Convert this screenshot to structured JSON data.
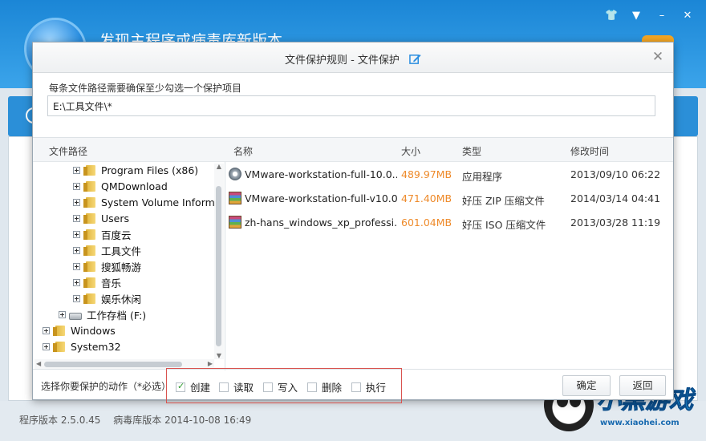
{
  "background": {
    "title": "发现主程序或病毒库新版本",
    "footer": {
      "program_version": "程序版本 2.5.0.45",
      "virus_db_version": "病毒库版本 2014-10-08 16:49"
    },
    "watermark": {
      "text": "小黑游戏",
      "url": "www.xiaohei.com"
    }
  },
  "dialog": {
    "title": "文件保护规则 - 文件保护",
    "hint": "每条文件路径需要确保至少勾选一个保护项目",
    "path_value": "E:\\工具文件\\*",
    "tree_header": "文件路径",
    "file_headers": {
      "name": "名称",
      "size": "大小",
      "type": "类型",
      "mtime": "修改时间"
    },
    "tree_items": [
      {
        "label": "Program Files (x86)",
        "icon": "folder-icon"
      },
      {
        "label": "QMDownload",
        "icon": "folder-icon"
      },
      {
        "label": "System Volume Informa",
        "icon": "folder-icon"
      },
      {
        "label": "Users",
        "icon": "folder-icon"
      },
      {
        "label": "百度云",
        "icon": "folder-icon"
      },
      {
        "label": "工具文件",
        "icon": "folder-icon",
        "selected": true
      },
      {
        "label": "搜狐畅游",
        "icon": "folder-icon"
      },
      {
        "label": "音乐",
        "icon": "folder-icon"
      },
      {
        "label": "娱乐休闲",
        "icon": "folder-icon"
      },
      {
        "label": "工作存档 (F:)",
        "icon": "drive-icon"
      },
      {
        "label": "Windows",
        "icon": "folder-icon"
      },
      {
        "label": "System32",
        "icon": "folder-icon"
      }
    ],
    "files": [
      {
        "name": "VMware-workstation-full-10.0...",
        "size": "489.97MB",
        "type": "应用程序",
        "mtime": "2013/09/10 06:22",
        "icon": "exe-icon"
      },
      {
        "name": "VMware-workstation-full-v10.0...",
        "size": "471.40MB",
        "type": "好压 ZIP 压缩文件",
        "mtime": "2014/03/14 04:41",
        "icon": "zip-archive-icon"
      },
      {
        "name": "zh-hans_windows_xp_professi...",
        "size": "601.04MB",
        "type": "好压 ISO 压缩文件",
        "mtime": "2013/03/28 11:19",
        "icon": "iso-archive-icon"
      }
    ],
    "actions_label": "选择你要保护的动作（*必选）",
    "actions": [
      {
        "label": "创建",
        "checked": true
      },
      {
        "label": "读取",
        "checked": false
      },
      {
        "label": "写入",
        "checked": false
      },
      {
        "label": "删除",
        "checked": false
      },
      {
        "label": "执行",
        "checked": false
      }
    ],
    "ok_label": "确定",
    "back_label": "返回"
  }
}
